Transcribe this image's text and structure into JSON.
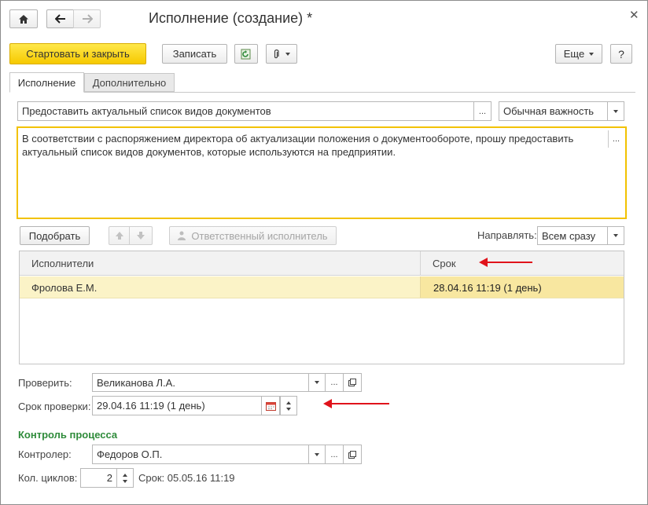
{
  "window": {
    "title": "Исполнение (создание) *",
    "close_icon": "close-icon",
    "home_icon": "home-icon",
    "back_icon": "arrow-left-icon",
    "forward_icon": "arrow-right-icon"
  },
  "toolbar": {
    "start_close_label": "Стартовать и закрыть",
    "save_label": "Записать",
    "more_label": "Еще",
    "help_label": "?"
  },
  "tabs": [
    {
      "label": "Исполнение",
      "active": true
    },
    {
      "label": "Дополнительно",
      "active": false
    }
  ],
  "form": {
    "subject": "Предоставить актуальный список видов документов",
    "importance": "Обычная важность",
    "description": "В соответствии с распоряжением директора об актуализации положения о документообороте, прошу предоставить актуальный список видов документов, которые используются на предприятии."
  },
  "executors": {
    "pick_label": "Подобрать",
    "responsible_label": "Ответственный исполнитель",
    "direct_label": "Направлять:",
    "direct_value": "Всем сразу",
    "columns": [
      "Исполнители",
      "Срок"
    ],
    "rows": [
      {
        "name": "Фролова Е.М.",
        "deadline": "28.04.16 11:19 (1 день)"
      }
    ]
  },
  "check": {
    "checker_label": "Проверить:",
    "checker_value": "Великанова Л.А.",
    "deadline_label": "Срок проверки:",
    "deadline_value": "29.04.16 11:19 (1 день)"
  },
  "control": {
    "section_title": "Контроль процесса",
    "controller_label": "Контролер:",
    "controller_value": "Федоров О.П.",
    "cycles_label": "Кол. циклов:",
    "cycles_value": "2",
    "term_text": "Срок: 05.05.16 11:19"
  },
  "colors": {
    "accent_yellow": "#f6c900",
    "selected_row": "#fbf3c7",
    "section_green": "#2e8b3a",
    "annotation_red": "#e0131b"
  }
}
